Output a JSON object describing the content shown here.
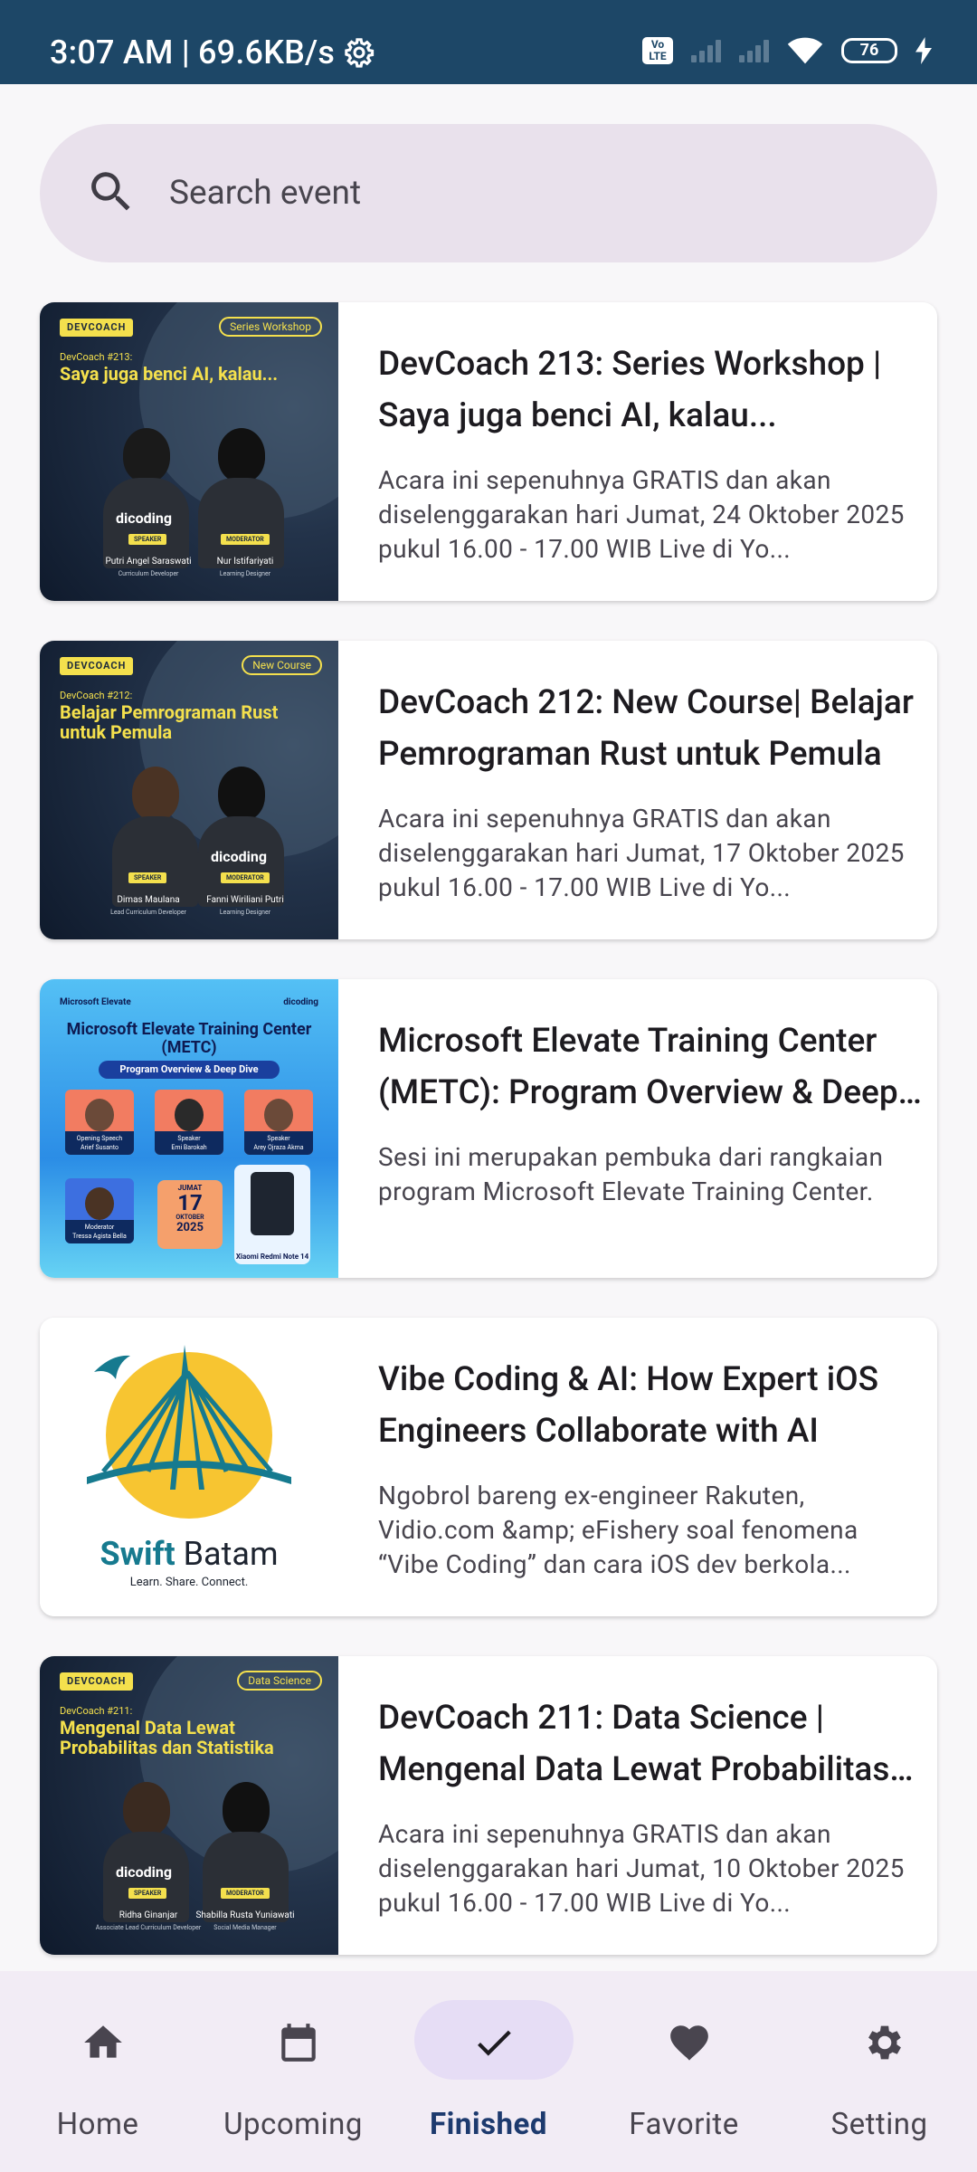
{
  "status_bar": {
    "time_speed": "3:07 AM | 69.6KB/s",
    "volte": "Vo LTE",
    "battery": "76"
  },
  "search": {
    "placeholder": "Search event"
  },
  "events": [
    {
      "title": "DevCoach 213: Series Workshop | Saya juga benci AI, kalau...",
      "description": "Acara ini sepenuhnya GRATIS dan akan diselenggarakan hari Jumat, 24 Oktober 2025 pukul 16.00 - 17.00 WIB Live di Yo...",
      "thumb": {
        "logo": "DEVCOACH",
        "tag": "Series Workshop",
        "sub": "DevCoach #213:",
        "headline": "Saya juga benci AI, kalau...",
        "left_role": "SPEAKER",
        "left_name": "Putri Angel Saraswati",
        "left_title": "Curriculum Developer",
        "right_role": "MODERATOR",
        "right_name": "Nur Istifariyati",
        "right_title": "Learning Designer",
        "brand": "dicoding"
      }
    },
    {
      "title": "DevCoach 212: New Course| Belajar Pemrograman Rust untuk Pemula",
      "description": "Acara ini sepenuhnya GRATIS dan akan diselenggarakan hari Jumat, 17 Oktober 2025 pukul 16.00 - 17.00 WIB Live di Yo...",
      "thumb": {
        "logo": "DEVCOACH",
        "tag": "New Course",
        "sub": "DevCoach #212:",
        "headline": "Belajar Pemrograman Rust untuk Pemula",
        "left_role": "SPEAKER",
        "left_name": "Dimas Maulana",
        "left_title": "Lead Curriculum Developer",
        "right_role": "MODERATOR",
        "right_name": "Fanni Wiriliani Putri",
        "right_title": "Learning Designer",
        "brand": "dicoding"
      }
    },
    {
      "title": "Microsoft Elevate Training Center (METC): Program Overview & Deep Dive",
      "description": "Sesi ini merupakan pembuka dari rangkaian program Microsoft Elevate Training Center.",
      "thumb": {
        "corner_left": "Microsoft Elevate",
        "corner_right": "dicoding",
        "title": "Microsoft Elevate Training Center (METC)",
        "banner": "Program Overview & Deep Dive",
        "p1_role": "Opening Speech",
        "p1_name": "Arief Susanto",
        "p2_role": "Speaker",
        "p2_name": "Emi Barokah",
        "p3_role": "Speaker",
        "p3_name": "Arey Ojraza Akma",
        "p4_role": "Moderator",
        "p4_name": "Tressa Agista Bella",
        "date_day": "JUMAT",
        "date_num": "17",
        "date_month": "OKTOBER",
        "date_year": "2025",
        "prize": "Xiaomi Redmi Note 14"
      }
    },
    {
      "title": "Vibe Coding & AI: How Expert iOS Engineers Collaborate with AI",
      "description": "Ngobrol bareng ex-engineer Rakuten, Vidio.com &amp; eFishery soal fenomena “Vibe Coding” dan cara iOS dev berkola...",
      "thumb": {
        "name_a": "Swift",
        "name_b": " Batam",
        "tagline": "Learn. Share. Connect."
      }
    },
    {
      "title": "DevCoach 211: Data Science | Mengenal Data Lewat Probabilitas dan Statistika",
      "description": "Acara ini sepenuhnya GRATIS dan akan diselenggarakan hari Jumat, 10 Oktober 2025 pukul 16.00 - 17.00 WIB Live di Yo...",
      "thumb": {
        "logo": "DEVCOACH",
        "tag": "Data Science",
        "sub": "DevCoach #211:",
        "headline": "Mengenal Data Lewat Probabilitas dan Statistika",
        "left_role": "SPEAKER",
        "left_name": "Ridha Ginanjar",
        "left_title": "Associate Lead Curriculum Developer",
        "right_role": "MODERATOR",
        "right_name": "Shabilla Rusta Yuniawati",
        "right_title": "Social Media Manager",
        "brand": "dicoding"
      }
    }
  ],
  "nav": [
    {
      "label": "Home",
      "icon": "home-icon",
      "active": false
    },
    {
      "label": "Upcoming",
      "icon": "calendar-icon",
      "active": false
    },
    {
      "label": "Finished",
      "icon": "check-icon",
      "active": true
    },
    {
      "label": "Favorite",
      "icon": "heart-icon",
      "active": false
    },
    {
      "label": "Setting",
      "icon": "gear-icon",
      "active": false
    }
  ],
  "colors": {
    "status_bar": "#1d4767",
    "search_bg": "#e9e1ec",
    "nav_bg": "#f2ecf5",
    "nav_active_pill": "#e6ddf5",
    "nav_active_label": "#1d3a6e",
    "devcoach_yellow": "#f4e04d"
  }
}
